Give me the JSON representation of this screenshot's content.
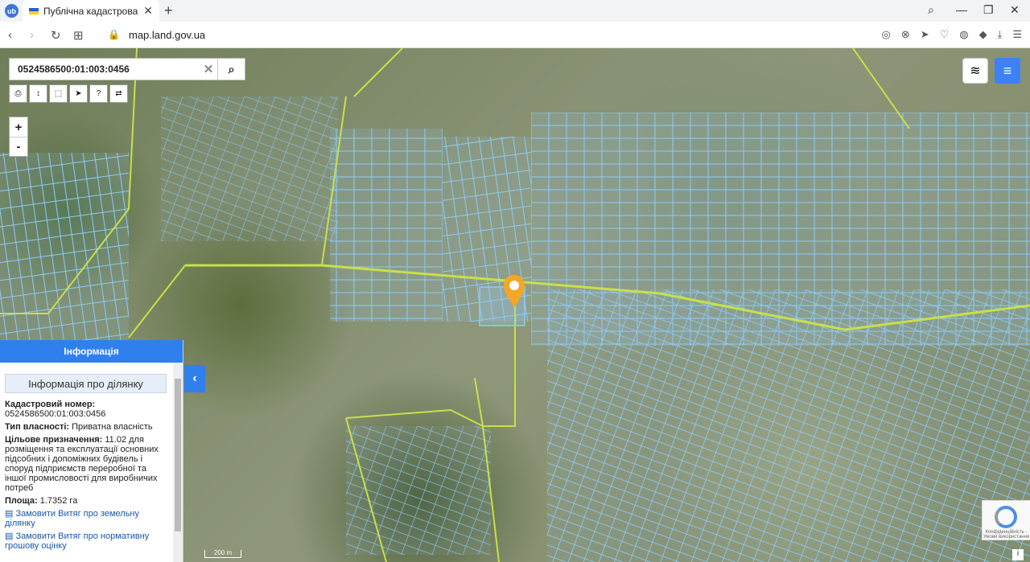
{
  "browser": {
    "tab_title": "Публічна кадастрова карта",
    "url": "map.land.gov.ua"
  },
  "search": {
    "value": "0524586500:01:003:0456"
  },
  "panel": {
    "header": "Інформація",
    "subheader": "Інформація про ділянку",
    "cadastral_label": "Кадастровий номер:",
    "cadastral_value": "0524586500:01:003:0456",
    "ownership_label": "Тип власності:",
    "ownership_value": "Приватна власність",
    "purpose_label": "Цільове призначення:",
    "purpose_value": "11.02 для розміщення та експлуатації основних підсобних і допоміжних будівель і споруд підприємств переробної та іншої промисловості для виробничих потреб",
    "area_label": "Площа:",
    "area_value": "1.7352 га",
    "link1": "Замовити Витяг про земельну ділянку",
    "link2": "Замовити Витяг про нормативну грошову оцінку"
  },
  "map": {
    "scale_label": "200 m",
    "zoom_in": "+",
    "zoom_out": "-",
    "captcha_text": "Конфіденційність - Умови використання",
    "info": "i"
  },
  "colors": {
    "accent": "#2f80ed",
    "parcel": "#8ecbf5",
    "boundary": "#c8e04a",
    "pin": "#f5a623"
  }
}
